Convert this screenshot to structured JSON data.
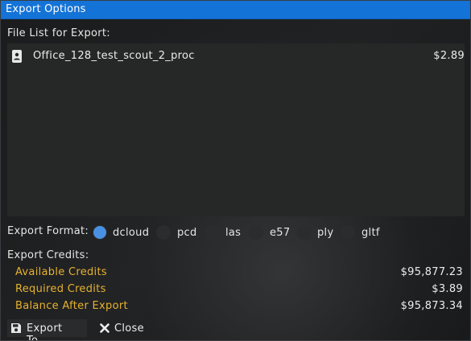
{
  "window": {
    "title": "Export Options"
  },
  "file_list": {
    "label": "File List for Export:",
    "files": [
      {
        "icon": "file-icon",
        "name": "Office_128_test_scout_2_proc",
        "price": "$2.89"
      }
    ]
  },
  "export_format": {
    "label": "Export Format:",
    "selected": "dcloud",
    "options": [
      "dcloud",
      "pcd",
      "las",
      "e57",
      "ply",
      "gltf"
    ]
  },
  "credits": {
    "label": "Export Credits:",
    "available_label": "Available Credits",
    "available_value": "$95,877.23",
    "required_label": "Required Credits",
    "required_value": "$3.89",
    "balance_label": "Balance After Export",
    "balance_value": "$95,873.34"
  },
  "buttons": {
    "export_label": "Export To...",
    "export_icon": "save-icon",
    "close_label": "Close",
    "close_icon": "close-icon"
  },
  "colors": {
    "titlebar": "#1473d6",
    "accent": "#4a90e2",
    "credit_label": "#e6b22f"
  }
}
